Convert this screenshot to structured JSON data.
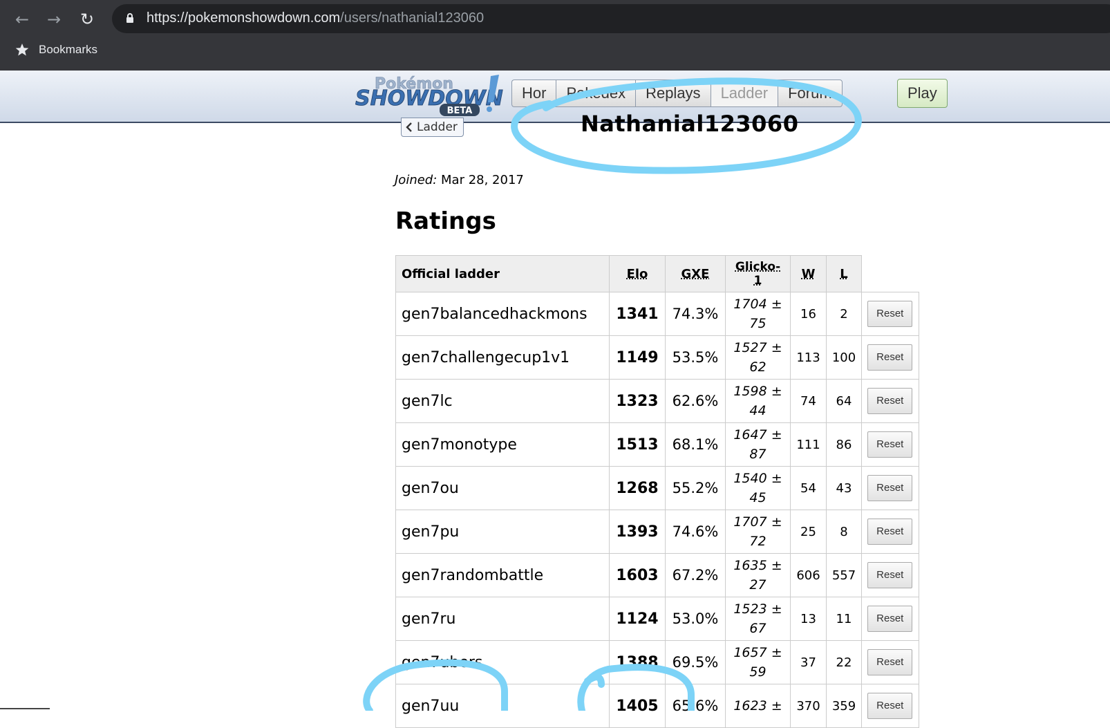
{
  "browser": {
    "url_host": "https://pokemonshowdown.com",
    "url_path": "/users/nathanial123060",
    "bookmarks_label": "Bookmarks"
  },
  "header": {
    "logo_text_top": "Pokémon",
    "logo_text_main": "SHOWDOWN",
    "logo_text_badge": "BETA",
    "tabs": [
      {
        "label": "Hor"
      },
      {
        "label": "Pokedex"
      },
      {
        "label": "Replays"
      },
      {
        "label": "Ladder"
      },
      {
        "label": "Forum"
      }
    ],
    "play_label": "Play"
  },
  "profile": {
    "back_label": "Ladder",
    "username": "Nathanial123060",
    "joined_label": "Joined:",
    "joined_date": "Mar 28, 2017",
    "ratings_heading": "Ratings"
  },
  "table": {
    "headers": {
      "ladder": "Official ladder",
      "elo": "Elo",
      "gxe": "GXE",
      "glicko_1": "Glicko-",
      "glicko_2": "1",
      "w": "W",
      "l": "L"
    },
    "reset_label": "Reset",
    "rows": [
      {
        "format": "gen7balancedhackmons",
        "elo": "1341",
        "gxe": "74.3%",
        "glicko": "1704 ±",
        "dev": "75",
        "w": "16",
        "l": "2"
      },
      {
        "format": "gen7challengecup1v1",
        "elo": "1149",
        "gxe": "53.5%",
        "glicko": "1527 ±",
        "dev": "62",
        "w": "113",
        "l": "100"
      },
      {
        "format": "gen7lc",
        "elo": "1323",
        "gxe": "62.6%",
        "glicko": "1598 ±",
        "dev": "44",
        "w": "74",
        "l": "64"
      },
      {
        "format": "gen7monotype",
        "elo": "1513",
        "gxe": "68.1%",
        "glicko": "1647 ±",
        "dev": "87",
        "w": "111",
        "l": "86"
      },
      {
        "format": "gen7ou",
        "elo": "1268",
        "gxe": "55.2%",
        "glicko": "1540 ±",
        "dev": "45",
        "w": "54",
        "l": "43"
      },
      {
        "format": "gen7pu",
        "elo": "1393",
        "gxe": "74.6%",
        "glicko": "1707 ±",
        "dev": "72",
        "w": "25",
        "l": "8"
      },
      {
        "format": "gen7randombattle",
        "elo": "1603",
        "gxe": "67.2%",
        "glicko": "1635 ±",
        "dev": "27",
        "w": "606",
        "l": "557"
      },
      {
        "format": "gen7ru",
        "elo": "1124",
        "gxe": "53.0%",
        "glicko": "1523 ±",
        "dev": "67",
        "w": "13",
        "l": "11"
      },
      {
        "format": "gen7ubers",
        "elo": "1388",
        "gxe": "69.5%",
        "glicko": "1657 ±",
        "dev": "59",
        "w": "37",
        "l": "22"
      },
      {
        "format": "gen7uu",
        "elo": "1405",
        "gxe": "65.6%",
        "glicko": "1623 ±",
        "dev": "",
        "w": "370",
        "l": "359"
      }
    ]
  },
  "colors": {
    "annotation": "#7dd3f7",
    "chrome": "#35363a",
    "omnibox": "#202124"
  }
}
